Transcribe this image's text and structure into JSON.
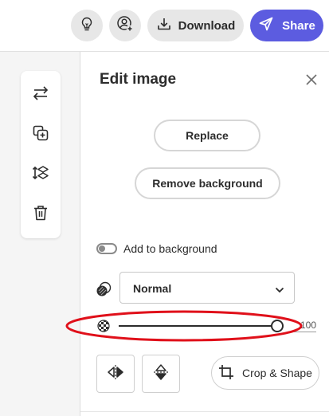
{
  "header": {
    "download_label": "Download",
    "share_label": "Share",
    "icons": {
      "bulb": "lightbulb-icon",
      "user": "add-user-icon",
      "download": "download-icon",
      "share": "send-icon"
    },
    "accent_color": "#5c5ce0"
  },
  "toolbar": {
    "items": [
      {
        "icon": "swap-icon"
      },
      {
        "icon": "duplicate-icon"
      },
      {
        "icon": "layer-arrange-icon"
      },
      {
        "icon": "trash-icon"
      }
    ]
  },
  "edit_panel": {
    "title": "Edit image",
    "replace_label": "Replace",
    "remove_background_label": "Remove background",
    "add_to_background_label": "Add to background",
    "add_to_background_on": false,
    "blend_mode": "Normal",
    "opacity_value": "100",
    "opacity_level": 1.0,
    "crop_shape_label": "Crop & Shape",
    "icons": {
      "close": "close-icon",
      "blend": "blend-mode-icon",
      "opacity": "opacity-checker-icon",
      "flip_horizontal": "flip-horizontal-icon",
      "flip_vertical": "flip-vertical-icon",
      "crop": "crop-icon",
      "chevron": "chevron-down-icon"
    },
    "annotation_color": "#e0101a"
  }
}
